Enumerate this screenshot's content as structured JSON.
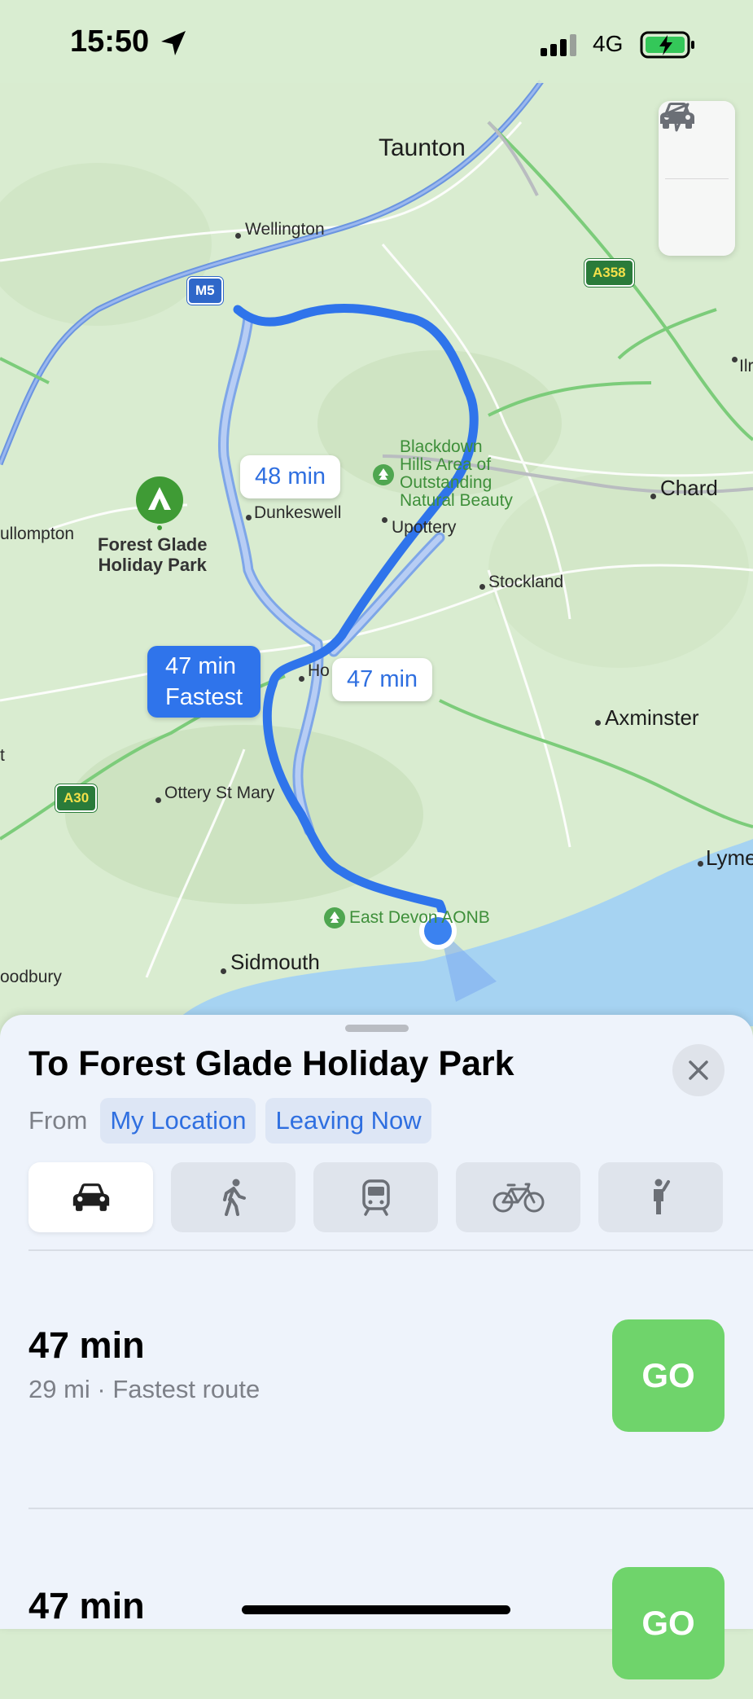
{
  "status_bar": {
    "time": "15:50",
    "network": "4G"
  },
  "map": {
    "places": {
      "taunton": "Taunton",
      "wellington": "Wellington",
      "chard": "Chard",
      "ilminster": "Ilr",
      "cullompton": "ullompton",
      "dunkeswell": "Dunkeswell",
      "upottery": "Upottery",
      "stockland": "Stockland",
      "honiton": "Ho",
      "axminster": "Axminster",
      "ottery": "Ottery St Mary",
      "lyme": "Lyme",
      "sidmouth": "Sidmouth",
      "woodbury": "oodbury",
      "left_edge": "t"
    },
    "destination_pin": {
      "line1": "Forest Glade",
      "line2": "Holiday Park"
    },
    "aonb_blackdown": {
      "l1": "Blackdown",
      "l2": "Hills Area of",
      "l3": "Outstanding",
      "l4": "Natural Beauty"
    },
    "aonb_eastdevon": "East Devon AONB",
    "roads": {
      "m5": "M5",
      "a358": "A358",
      "a30": "A30"
    },
    "route_callouts": {
      "alt1": "48 min",
      "alt2": "47 min",
      "selected_time": "47 min",
      "selected_tag": "Fastest"
    }
  },
  "sheet": {
    "title": "To Forest Glade Holiday Park",
    "from_label": "From",
    "origin_chip": "My Location",
    "time_chip": "Leaving Now",
    "transport_modes": [
      "car-icon",
      "walk-icon",
      "transit-icon",
      "cycle-icon",
      "rideshare-icon"
    ],
    "active_mode": "car",
    "routes": [
      {
        "duration": "47 min",
        "detail": "29 mi · Fastest route",
        "go": "GO"
      },
      {
        "duration": "47 min",
        "detail": "",
        "go": "GO"
      }
    ]
  },
  "colors": {
    "route_selected": "#2f74eb",
    "route_alt": "#a8c4f2",
    "go_green": "#6fd46b",
    "water": "#a6d3f2"
  }
}
